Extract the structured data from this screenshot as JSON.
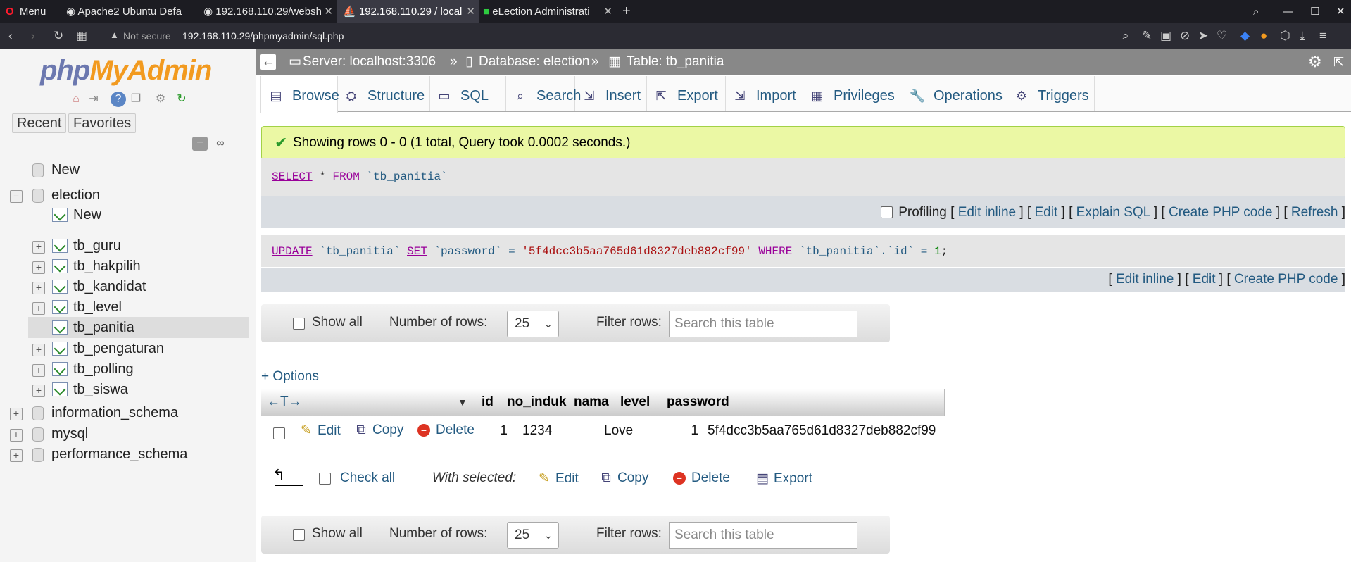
{
  "browser": {
    "menu_label": "Menu",
    "tabs": [
      {
        "label": "Apache2 Ubuntu Defa"
      },
      {
        "label": "192.168.110.29/websh"
      },
      {
        "label": "192.168.110.29 / local"
      },
      {
        "label": "eLection Administrati"
      }
    ],
    "new_tab": "+",
    "security": "Not secure",
    "url": "192.168.110.29/phpmyadmin/sql.php"
  },
  "sidebar": {
    "logo_php": "php",
    "logo_myadmin": "MyAdmin",
    "recent": "Recent",
    "favorites": "Favorites",
    "new_db": "New",
    "db_election": "election",
    "election_new": "New",
    "tables": [
      "tb_guru",
      "tb_hakpilih",
      "tb_kandidat",
      "tb_level",
      "tb_panitia",
      "tb_pengaturan",
      "tb_polling",
      "tb_siswa"
    ],
    "other_dbs": [
      "information_schema",
      "mysql",
      "performance_schema"
    ]
  },
  "breadcrumb": {
    "server": "Server: localhost:3306",
    "database": "Database: election",
    "table": "Table: tb_panitia",
    "sep": "»"
  },
  "tabs": [
    "Browse",
    "Structure",
    "SQL",
    "Search",
    "Insert",
    "Export",
    "Import",
    "Privileges",
    "Operations",
    "Triggers"
  ],
  "success": "Showing rows 0 - 0 (1 total, Query took 0.0002 seconds.)",
  "query1": {
    "kw_select": "SELECT",
    "star": " * ",
    "kw_from": "FROM",
    "table": " `tb_panitia`"
  },
  "query1_links": {
    "profiling": "Profiling",
    "edit_inline": "Edit inline",
    "edit": "Edit",
    "explain": "Explain SQL",
    "create_php": "Create PHP code",
    "refresh": "Refresh"
  },
  "query2": {
    "kw_update": "UPDATE",
    "table": " `tb_panitia` ",
    "kw_set": "SET",
    "col": " `password` = ",
    "val": "'5f4dcc3b5aa765d61d8327deb882cf99'",
    "kw_where": " WHERE ",
    "cond": "`tb_panitia`.`id` = ",
    "num": "1",
    "end": ";"
  },
  "query2_links": {
    "edit_inline": "Edit inline",
    "edit": "Edit",
    "create_php": "Create PHP code"
  },
  "nav": {
    "show_all": "Show all",
    "num_rows_label": "Number of rows:",
    "num_rows": "25",
    "filter_label": "Filter rows:",
    "filter_placeholder": "Search this table"
  },
  "options": "+ Options",
  "table": {
    "columns": [
      "id",
      "no_induk",
      "nama",
      "level",
      "password"
    ],
    "rows": [
      {
        "id": "1",
        "no_induk": "1234",
        "nama": "Love",
        "level": "1",
        "password": "5f4dcc3b5aa765d61d8327deb882cf99"
      }
    ],
    "row_actions": {
      "edit": "Edit",
      "copy": "Copy",
      "delete": "Delete"
    }
  },
  "bulk": {
    "check_all": "Check all",
    "with_selected": "With selected:",
    "edit": "Edit",
    "copy": "Copy",
    "delete": "Delete",
    "export": "Export"
  }
}
